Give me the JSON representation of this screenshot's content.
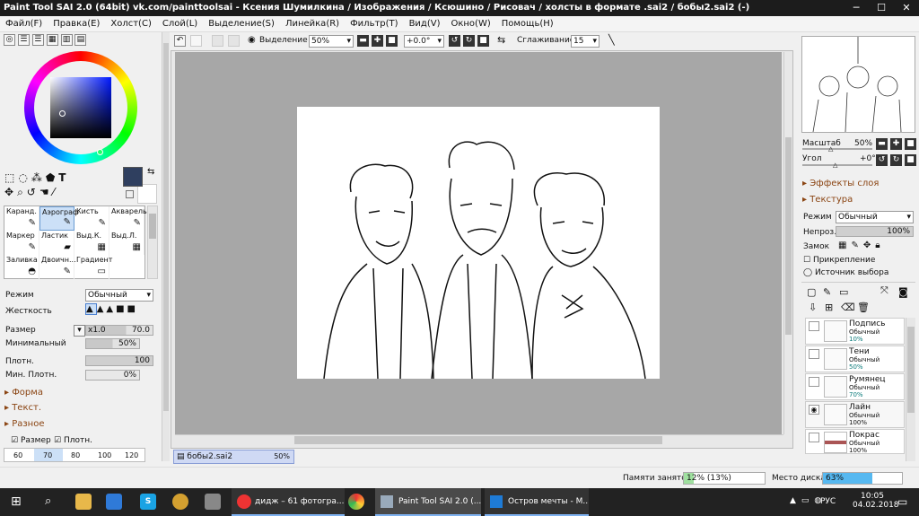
{
  "window": {
    "title": "Paint Tool SAI 2.0 (64bit) vk.com/painttoolsai - Ксения Шумилкина / Изображения / Ксюшино / Рисовач / холсты в формате .sai2 / бобы2.sai2 (-)",
    "min": "─",
    "max": "☐",
    "close": "✕"
  },
  "menu": [
    "Файл(F)",
    "Правка(E)",
    "Холст(C)",
    "Слой(L)",
    "Выделение(S)",
    "Линейка(R)",
    "Фильтр(T)",
    "Вид(V)",
    "Окно(W)",
    "Помощь(H)"
  ],
  "toolbar": {
    "selection_label": "Выделение",
    "zoom": "50%",
    "angle": "+0.0°",
    "smoothing_label": "Сглаживание",
    "smoothing": "15"
  },
  "color": {
    "current": "#2f3f5f",
    "secondary": "#ffffff"
  },
  "tools": [
    {
      "name": "Каранд.",
      "icon": "✎"
    },
    {
      "name": "Аэрограф",
      "icon": "✎"
    },
    {
      "name": "Кисть",
      "icon": "✎"
    },
    {
      "name": "Акварель",
      "icon": "✎"
    },
    {
      "name": "Маркер",
      "icon": "✎"
    },
    {
      "name": "Ластик",
      "icon": "▰"
    },
    {
      "name": "Выд.К.",
      "icon": "▦"
    },
    {
      "name": "Выд.Л.",
      "icon": "▦"
    },
    {
      "name": "Заливка",
      "icon": "◓"
    },
    {
      "name": "Двоичн...",
      "icon": "✎"
    },
    {
      "name": "Градиент",
      "icon": "▭"
    }
  ],
  "brush": {
    "mode_label": "Режим",
    "mode": "Обычный",
    "hardness_label": "Жесткость",
    "size_label": "Размер",
    "size_mult": "x1.0",
    "size": "70.0",
    "min_label": "Минимальный",
    "min": "50%",
    "density_label": "Плотн.",
    "density": "100",
    "min_density_label": "Мин. Плотн.",
    "min_density": "0%",
    "sections": [
      "Форма",
      "Текст.",
      "Разное"
    ],
    "checks": [
      "Размер",
      "Плотн."
    ],
    "sizes": [
      "60",
      "70",
      "80",
      "100",
      "120"
    ]
  },
  "document_tab": {
    "name": "бобы2.sai2",
    "zoom": "50%"
  },
  "navigator": {
    "zoom_label": "Масштаб",
    "zoom": "50%",
    "angle_label": "Угол",
    "angle": "+0°"
  },
  "layer_panel": {
    "effects": "Эффекты слоя",
    "texture": "Текстура",
    "mode_label": "Режим",
    "mode": "Обычный",
    "opacity_label": "Непроз.",
    "opacity": "100%",
    "lock_label": "Замок",
    "pin_label": "Прикрепление",
    "source_label": "Источник выбора"
  },
  "layers": [
    {
      "name": "Подпись",
      "mode": "Обычный",
      "opacity": "10%"
    },
    {
      "name": "Тени",
      "mode": "Обычный",
      "opacity": "50%"
    },
    {
      "name": "Румянец",
      "mode": "Обычный",
      "opacity": "70%"
    },
    {
      "name": "Лайн",
      "mode": "Обычный",
      "opacity": "100%"
    },
    {
      "name": "Покрас",
      "mode": "Обычный",
      "opacity": "100%"
    }
  ],
  "status": {
    "memory_label": "Памяти занято",
    "memory": "12% (13%)",
    "memory_pct": 0.12,
    "disk_label": "Место диска",
    "disk": "63%",
    "disk_pct": 0.63
  },
  "taskbar": {
    "items": [
      "дидж – 61 фотогра...",
      "Paint Tool SAI 2.0 (...",
      "Остров мечты - M..."
    ],
    "lang": "РУС",
    "time": "10:05",
    "date": "04.02.2018"
  }
}
